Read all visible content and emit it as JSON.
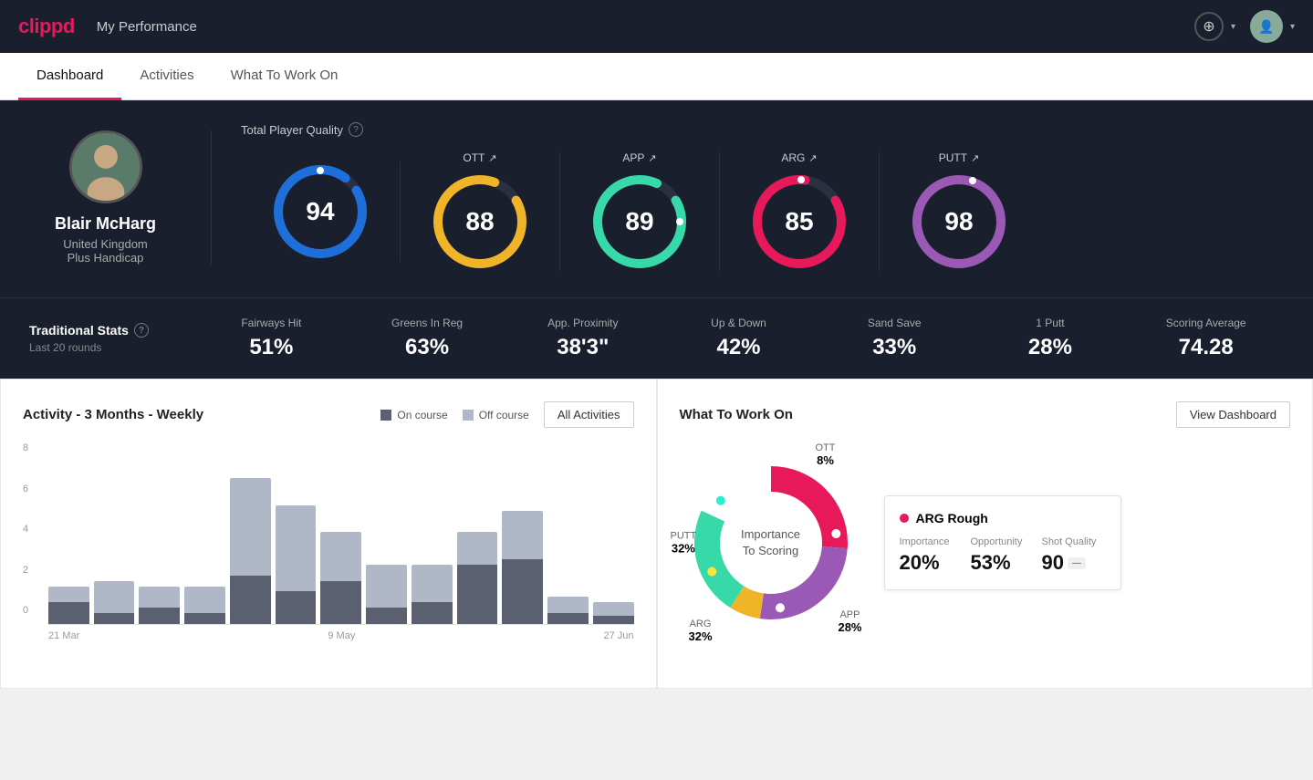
{
  "header": {
    "logo": "clippd",
    "title": "My Performance",
    "add_label": "+",
    "chevron": "▾"
  },
  "tabs": [
    {
      "id": "dashboard",
      "label": "Dashboard",
      "active": true
    },
    {
      "id": "activities",
      "label": "Activities",
      "active": false
    },
    {
      "id": "what-to-work-on",
      "label": "What To Work On",
      "active": false
    }
  ],
  "player": {
    "name": "Blair McHarg",
    "country": "United Kingdom",
    "handicap": "Plus Handicap"
  },
  "tpq": {
    "label": "Total Player Quality",
    "main_score": "94",
    "categories": [
      {
        "id": "ott",
        "label": "OTT",
        "score": "88",
        "color": "#f0b429"
      },
      {
        "id": "app",
        "label": "APP",
        "score": "89",
        "color": "#38d9a9"
      },
      {
        "id": "arg",
        "label": "ARG",
        "score": "85",
        "color": "#e8195a"
      },
      {
        "id": "putt",
        "label": "PUTT",
        "score": "98",
        "color": "#9b59b6"
      }
    ]
  },
  "trad_stats": {
    "title": "Traditional Stats",
    "subtitle": "Last 20 rounds",
    "items": [
      {
        "label": "Fairways Hit",
        "value": "51%"
      },
      {
        "label": "Greens In Reg",
        "value": "63%"
      },
      {
        "label": "App. Proximity",
        "value": "38'3\""
      },
      {
        "label": "Up & Down",
        "value": "42%"
      },
      {
        "label": "Sand Save",
        "value": "33%"
      },
      {
        "label": "1 Putt",
        "value": "28%"
      },
      {
        "label": "Scoring Average",
        "value": "74.28"
      }
    ]
  },
  "activity_chart": {
    "title": "Activity - 3 Months - Weekly",
    "legend": [
      {
        "label": "On course",
        "color": "#5a6070"
      },
      {
        "label": "Off course",
        "color": "#b0b8c8"
      }
    ],
    "button": "All Activities",
    "y_labels": [
      "0",
      "2",
      "4",
      "6",
      "8"
    ],
    "x_labels": [
      "21 Mar",
      "9 May",
      "27 Jun"
    ],
    "bars": [
      {
        "on": 20,
        "off": 15
      },
      {
        "on": 10,
        "off": 30
      },
      {
        "on": 15,
        "off": 20
      },
      {
        "on": 10,
        "off": 25
      },
      {
        "on": 45,
        "off": 90
      },
      {
        "on": 30,
        "off": 80
      },
      {
        "on": 40,
        "off": 45
      },
      {
        "on": 15,
        "off": 40
      },
      {
        "on": 20,
        "off": 35
      },
      {
        "on": 55,
        "off": 30
      },
      {
        "on": 60,
        "off": 45
      },
      {
        "on": 10,
        "off": 15
      },
      {
        "on": 8,
        "off": 12
      }
    ]
  },
  "what_to_work_on": {
    "title": "What To Work On",
    "button": "View Dashboard",
    "center_text": "Importance\nTo Scoring",
    "segments": [
      {
        "label": "OTT",
        "percent": "8%",
        "color": "#f0b429"
      },
      {
        "label": "APP",
        "percent": "28%",
        "color": "#38d9a9"
      },
      {
        "label": "ARG",
        "percent": "32%",
        "color": "#e8195a"
      },
      {
        "label": "PUTT",
        "percent": "32%",
        "color": "#9b59b6"
      }
    ],
    "card": {
      "title": "ARG Rough",
      "stats": [
        {
          "label": "Importance",
          "value": "20%"
        },
        {
          "label": "Opportunity",
          "value": "53%"
        },
        {
          "label": "Shot Quality",
          "value": "90"
        }
      ]
    }
  }
}
